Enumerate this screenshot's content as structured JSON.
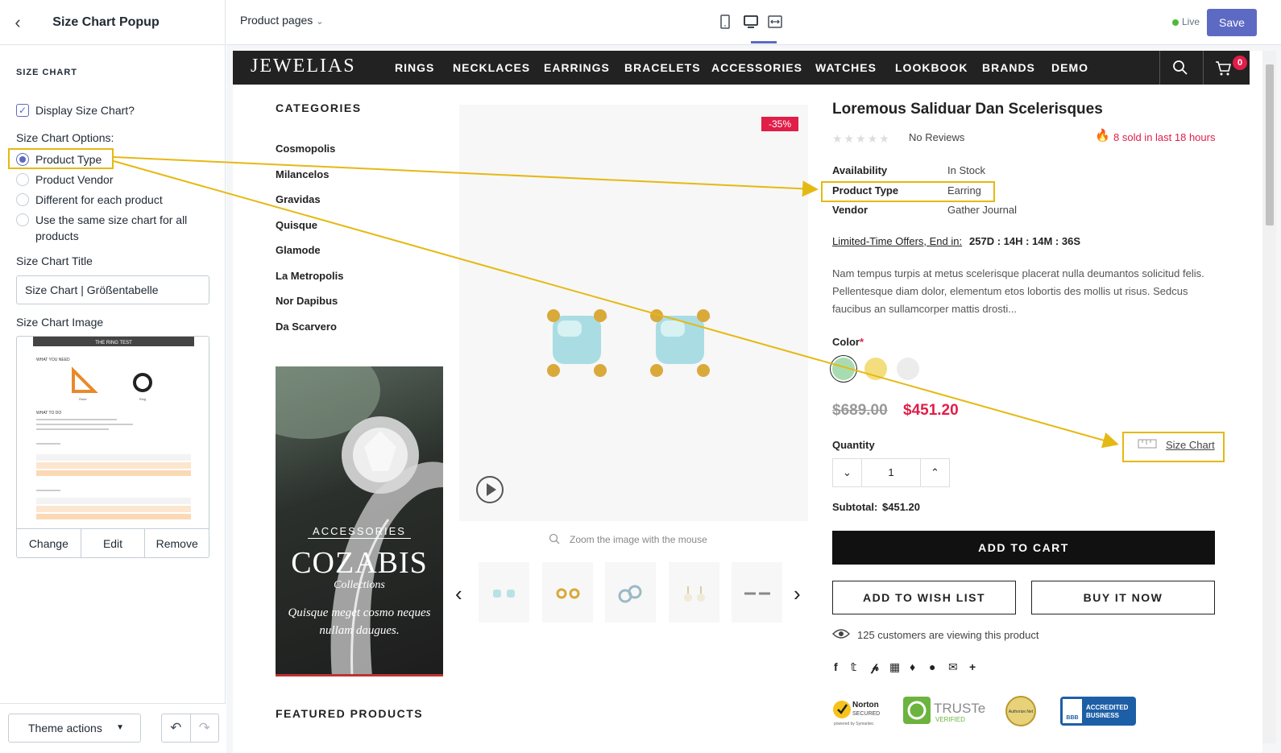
{
  "sidebar": {
    "title": "Size Chart Popup",
    "section": "SIZE CHART",
    "display_checkbox": "Display Size Chart?",
    "options_label": "Size Chart Options:",
    "options": [
      "Product Type",
      "Product Vendor",
      "Different for each product",
      "Use the same size chart for all products"
    ],
    "selected_option": "Product Type",
    "title_label": "Size Chart Title",
    "title_value": "Size Chart | Größentabelle",
    "image_label": "Size Chart Image",
    "image_preview": {
      "heading": "THE RING TEST",
      "need": "WHAT YOU NEED",
      "todo": "WHAT TO DO",
      "labels": [
        "Ruler",
        "Ring"
      ]
    },
    "image_actions": [
      "Change",
      "Edit",
      "Remove"
    ],
    "theme_actions": "Theme actions"
  },
  "topbar": {
    "page_select": "Product pages",
    "live": "Live",
    "save": "Save"
  },
  "store": {
    "logo": "JEWELIAS",
    "nav": [
      "RINGS",
      "NECKLACES",
      "EARRINGS",
      "BRACELETS",
      "ACCESSORIES",
      "WATCHES",
      "LOOKBOOK",
      "BRANDS",
      "DEMO"
    ],
    "cart_count": "0",
    "categories_title": "CATEGORIES",
    "categories": [
      "Cosmopolis",
      "Milancelos",
      "Gravidas",
      "Quisque",
      "Glamode",
      "La Metropolis",
      "Nor Dapibus",
      "Da Scarvero"
    ],
    "banner": {
      "sub": "ACCESSORIES",
      "title": "COZABIS",
      "collections": "Collections",
      "desc": "Quisque meget cosmo neques nullam daugues."
    },
    "featured": "FEATURED PRODUCTS"
  },
  "product": {
    "discount": "-35%",
    "zoom_hint": "Zoom the image with the mouse",
    "title": "Loremous Saliduar Dan Scelerisques",
    "reviews": "No Reviews",
    "sold": "8 sold in last 18 hours",
    "info": [
      {
        "k": "Availability",
        "v": "In Stock"
      },
      {
        "k": "Product Type",
        "v": "Earring"
      },
      {
        "k": "Vendor",
        "v": "Gather Journal"
      }
    ],
    "offer_label": "Limited-Time Offers, End in:",
    "offer_timer": "257D : 14H : 14M : 36S",
    "description": "Nam tempus turpis at metus scelerisque placerat nulla deumantos solicitud felis. Pellentesque diam dolor, elementum etos lobortis des mollis ut risus. Sedcus faucibus an sullamcorper mattis drosti...",
    "color_label": "Color",
    "required_mark": "*",
    "colors": [
      "#a8dcb0",
      "#f4dd7c",
      "#ececec"
    ],
    "price_old": "$689.00",
    "price_new": "$451.20",
    "quantity_label": "Quantity",
    "quantity": "1",
    "size_chart": "Size Chart",
    "subtotal_label": "Subtotal:",
    "subtotal": "$451.20",
    "add_to_cart": "ADD TO CART",
    "wish_list": "ADD TO WISH LIST",
    "buy_now": "BUY IT NOW",
    "viewing": "125 customers are viewing this product",
    "badges": {
      "norton": "Norton",
      "norton_sub": "SECURED",
      "norton_by": "powered by Symantec",
      "truste": "TRUSTe",
      "truste_sub": "VERIFIED",
      "authorize": "Authorize.Net",
      "bbb": "BBB",
      "bbb_text": [
        "ACCREDITED",
        "BUSINESS"
      ]
    }
  },
  "colors": {
    "accent": "#5c6ac4",
    "highlight": "#e5b913",
    "sale": "#e11d48"
  }
}
